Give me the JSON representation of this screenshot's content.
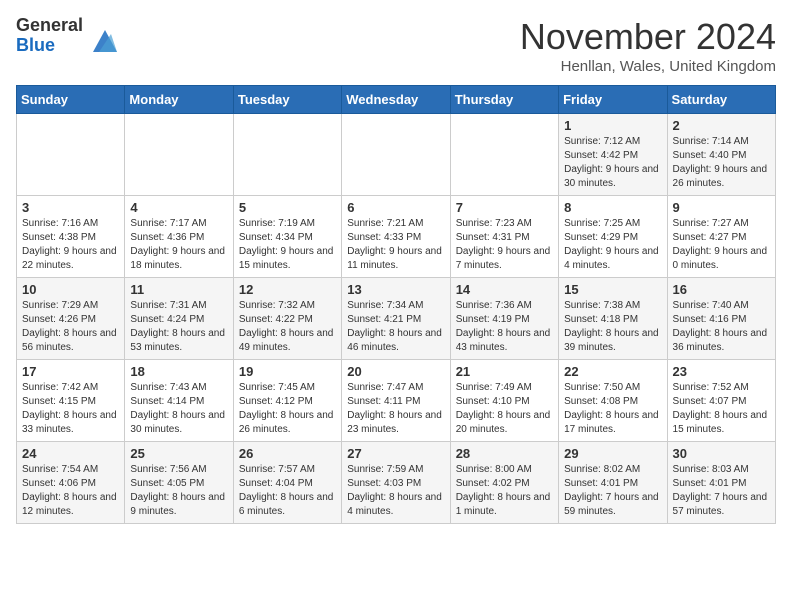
{
  "header": {
    "logo_general": "General",
    "logo_blue": "Blue",
    "month_title": "November 2024",
    "location": "Henllan, Wales, United Kingdom"
  },
  "days_of_week": [
    "Sunday",
    "Monday",
    "Tuesday",
    "Wednesday",
    "Thursday",
    "Friday",
    "Saturday"
  ],
  "weeks": [
    [
      {
        "day": "",
        "info": ""
      },
      {
        "day": "",
        "info": ""
      },
      {
        "day": "",
        "info": ""
      },
      {
        "day": "",
        "info": ""
      },
      {
        "day": "",
        "info": ""
      },
      {
        "day": "1",
        "info": "Sunrise: 7:12 AM\nSunset: 4:42 PM\nDaylight: 9 hours and 30 minutes."
      },
      {
        "day": "2",
        "info": "Sunrise: 7:14 AM\nSunset: 4:40 PM\nDaylight: 9 hours and 26 minutes."
      }
    ],
    [
      {
        "day": "3",
        "info": "Sunrise: 7:16 AM\nSunset: 4:38 PM\nDaylight: 9 hours and 22 minutes."
      },
      {
        "day": "4",
        "info": "Sunrise: 7:17 AM\nSunset: 4:36 PM\nDaylight: 9 hours and 18 minutes."
      },
      {
        "day": "5",
        "info": "Sunrise: 7:19 AM\nSunset: 4:34 PM\nDaylight: 9 hours and 15 minutes."
      },
      {
        "day": "6",
        "info": "Sunrise: 7:21 AM\nSunset: 4:33 PM\nDaylight: 9 hours and 11 minutes."
      },
      {
        "day": "7",
        "info": "Sunrise: 7:23 AM\nSunset: 4:31 PM\nDaylight: 9 hours and 7 minutes."
      },
      {
        "day": "8",
        "info": "Sunrise: 7:25 AM\nSunset: 4:29 PM\nDaylight: 9 hours and 4 minutes."
      },
      {
        "day": "9",
        "info": "Sunrise: 7:27 AM\nSunset: 4:27 PM\nDaylight: 9 hours and 0 minutes."
      }
    ],
    [
      {
        "day": "10",
        "info": "Sunrise: 7:29 AM\nSunset: 4:26 PM\nDaylight: 8 hours and 56 minutes."
      },
      {
        "day": "11",
        "info": "Sunrise: 7:31 AM\nSunset: 4:24 PM\nDaylight: 8 hours and 53 minutes."
      },
      {
        "day": "12",
        "info": "Sunrise: 7:32 AM\nSunset: 4:22 PM\nDaylight: 8 hours and 49 minutes."
      },
      {
        "day": "13",
        "info": "Sunrise: 7:34 AM\nSunset: 4:21 PM\nDaylight: 8 hours and 46 minutes."
      },
      {
        "day": "14",
        "info": "Sunrise: 7:36 AM\nSunset: 4:19 PM\nDaylight: 8 hours and 43 minutes."
      },
      {
        "day": "15",
        "info": "Sunrise: 7:38 AM\nSunset: 4:18 PM\nDaylight: 8 hours and 39 minutes."
      },
      {
        "day": "16",
        "info": "Sunrise: 7:40 AM\nSunset: 4:16 PM\nDaylight: 8 hours and 36 minutes."
      }
    ],
    [
      {
        "day": "17",
        "info": "Sunrise: 7:42 AM\nSunset: 4:15 PM\nDaylight: 8 hours and 33 minutes."
      },
      {
        "day": "18",
        "info": "Sunrise: 7:43 AM\nSunset: 4:14 PM\nDaylight: 8 hours and 30 minutes."
      },
      {
        "day": "19",
        "info": "Sunrise: 7:45 AM\nSunset: 4:12 PM\nDaylight: 8 hours and 26 minutes."
      },
      {
        "day": "20",
        "info": "Sunrise: 7:47 AM\nSunset: 4:11 PM\nDaylight: 8 hours and 23 minutes."
      },
      {
        "day": "21",
        "info": "Sunrise: 7:49 AM\nSunset: 4:10 PM\nDaylight: 8 hours and 20 minutes."
      },
      {
        "day": "22",
        "info": "Sunrise: 7:50 AM\nSunset: 4:08 PM\nDaylight: 8 hours and 17 minutes."
      },
      {
        "day": "23",
        "info": "Sunrise: 7:52 AM\nSunset: 4:07 PM\nDaylight: 8 hours and 15 minutes."
      }
    ],
    [
      {
        "day": "24",
        "info": "Sunrise: 7:54 AM\nSunset: 4:06 PM\nDaylight: 8 hours and 12 minutes."
      },
      {
        "day": "25",
        "info": "Sunrise: 7:56 AM\nSunset: 4:05 PM\nDaylight: 8 hours and 9 minutes."
      },
      {
        "day": "26",
        "info": "Sunrise: 7:57 AM\nSunset: 4:04 PM\nDaylight: 8 hours and 6 minutes."
      },
      {
        "day": "27",
        "info": "Sunrise: 7:59 AM\nSunset: 4:03 PM\nDaylight: 8 hours and 4 minutes."
      },
      {
        "day": "28",
        "info": "Sunrise: 8:00 AM\nSunset: 4:02 PM\nDaylight: 8 hours and 1 minute."
      },
      {
        "day": "29",
        "info": "Sunrise: 8:02 AM\nSunset: 4:01 PM\nDaylight: 7 hours and 59 minutes."
      },
      {
        "day": "30",
        "info": "Sunrise: 8:03 AM\nSunset: 4:01 PM\nDaylight: 7 hours and 57 minutes."
      }
    ]
  ]
}
